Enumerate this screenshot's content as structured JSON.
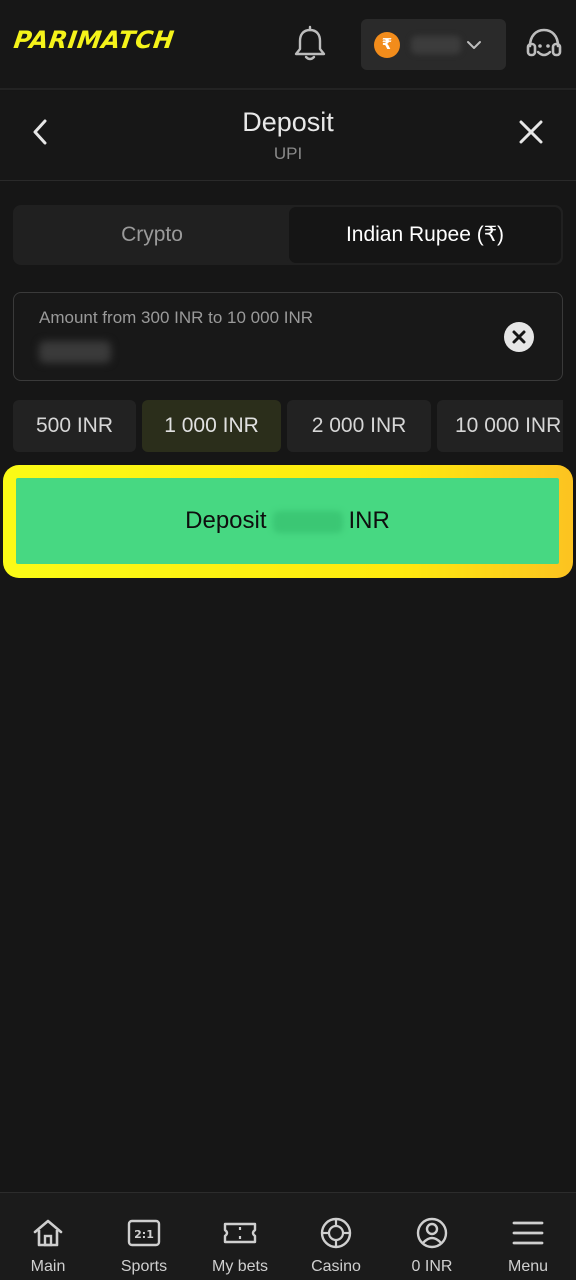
{
  "header": {
    "logo_text": "PARIMATCH",
    "currency_symbol": "₹"
  },
  "subheader": {
    "title": "Deposit",
    "subtitle": "UPI"
  },
  "tabs": [
    {
      "label": "Crypto",
      "active": false
    },
    {
      "label": "Indian Rupee (₹)",
      "active": true
    }
  ],
  "amount_field": {
    "placeholder": "Amount from 300 INR to 10 000 INR"
  },
  "presets": [
    {
      "label": "500 INR",
      "selected": false
    },
    {
      "label": "1 000 INR",
      "selected": true
    },
    {
      "label": "2 000 INR",
      "selected": false
    },
    {
      "label": "10 000 INR",
      "selected": false
    }
  ],
  "deposit_button": {
    "prefix": "Deposit",
    "suffix": "INR"
  },
  "bottom_nav": [
    {
      "label": "Main",
      "icon": "home-icon"
    },
    {
      "label": "Sports",
      "icon": "sports-odds-icon"
    },
    {
      "label": "My bets",
      "icon": "ticket-icon"
    },
    {
      "label": "Casino",
      "icon": "casino-chip-icon"
    },
    {
      "label": "0 INR",
      "icon": "account-icon"
    },
    {
      "label": "Menu",
      "icon": "menu-icon"
    }
  ],
  "colors": {
    "brand_yellow": "#f5f31a",
    "deposit_green": "#47d882",
    "coin_orange": "#f28c1b",
    "background": "#161616"
  }
}
